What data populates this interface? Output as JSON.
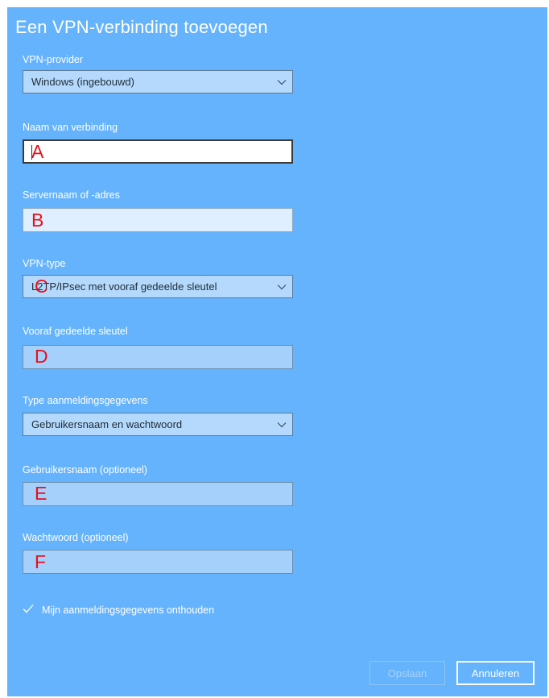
{
  "dialog": {
    "title": "Een VPN-verbinding toevoegen"
  },
  "provider": {
    "label": "VPN-provider",
    "value": "Windows (ingebouwd)",
    "icon": "chevron-down-icon"
  },
  "connection_name": {
    "label": "Naam van verbinding",
    "value": "",
    "annotation": "A"
  },
  "server": {
    "label": "Servernaam of -adres",
    "value": "",
    "annotation": "B"
  },
  "vpn_type": {
    "label": "VPN-type",
    "value": "L2TP/IPsec met vooraf gedeelde sleutel",
    "annotation": "C",
    "icon": "chevron-down-icon"
  },
  "psk": {
    "label": "Vooraf gedeelde sleutel",
    "value": "",
    "annotation": "D"
  },
  "signin_type": {
    "label": "Type aanmeldingsgegevens",
    "value": "Gebruikersnaam en wachtwoord",
    "icon": "chevron-down-icon"
  },
  "username": {
    "label": "Gebruikersnaam (optioneel)",
    "value": "",
    "annotation": "E"
  },
  "password": {
    "label": "Wachtwoord (optioneel)",
    "value": "",
    "annotation": "F"
  },
  "remember": {
    "label": "Mijn aanmeldingsgegevens onthouden",
    "checked": true,
    "icon": "checkmark-icon"
  },
  "buttons": {
    "save": "Opslaan",
    "cancel": "Annuleren"
  },
  "colors": {
    "background": "#65b3fc",
    "annotation": "#e8101a",
    "text": "#ffffff"
  }
}
